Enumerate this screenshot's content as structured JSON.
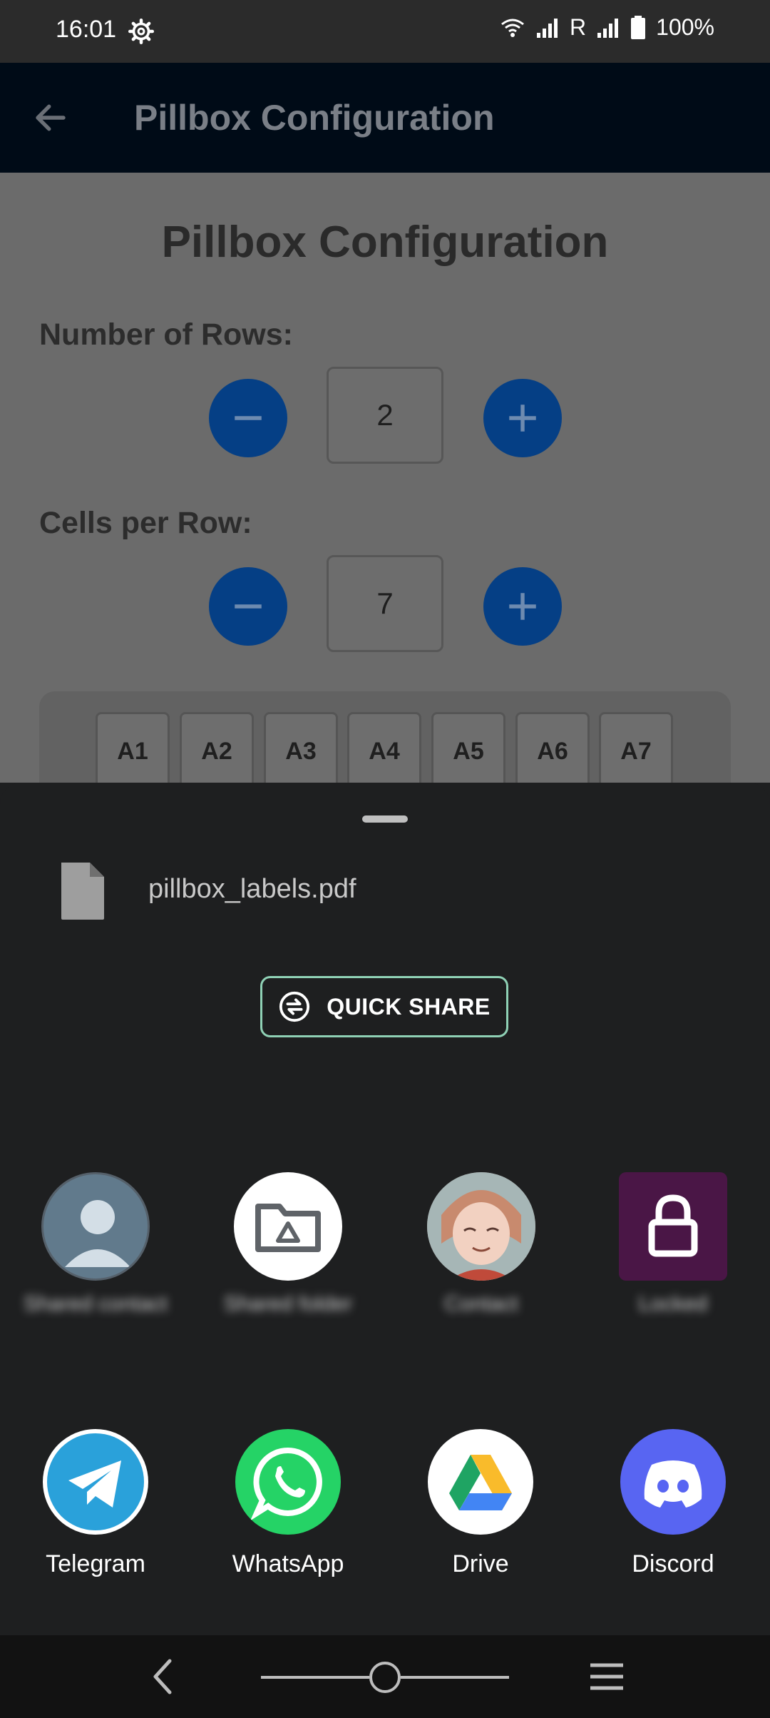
{
  "status_bar": {
    "time": "16:01",
    "roaming": "R",
    "battery": "100%"
  },
  "app_bar": {
    "title": "Pillbox Configuration"
  },
  "page": {
    "title": "Pillbox Configuration",
    "rows_label": "Number of Rows:",
    "rows_value": "2",
    "cells_label": "Cells per Row:",
    "cells_value": "7",
    "cells": [
      "A1",
      "A2",
      "A3",
      "A4",
      "A5",
      "A6",
      "A7"
    ]
  },
  "share_sheet": {
    "file_name": "pillbox_labels.pdf",
    "quick_share_label": "QUICK SHARE",
    "direct_targets": [
      {
        "label": "Shared contact",
        "icon": "person-icon"
      },
      {
        "label": "Shared folder",
        "icon": "drive-folder-icon"
      },
      {
        "label": "Contact",
        "icon": "avatar-icon"
      },
      {
        "label": "Locked",
        "icon": "lock-icon"
      }
    ],
    "apps": [
      {
        "label": "Telegram",
        "icon": "telegram-icon"
      },
      {
        "label": "WhatsApp",
        "icon": "whatsapp-icon"
      },
      {
        "label": "Drive",
        "icon": "drive-icon"
      },
      {
        "label": "Discord",
        "icon": "discord-icon"
      }
    ]
  },
  "colors": {
    "app_bar": "#000b17",
    "stepper_button": "#053f85",
    "sheet_bg": "#1e1f20",
    "quick_share_border": "#8fd1b5",
    "telegram": "#2aa1da",
    "whatsapp": "#25d366",
    "discord": "#5865f2",
    "lock_tile": "#4a1646"
  }
}
